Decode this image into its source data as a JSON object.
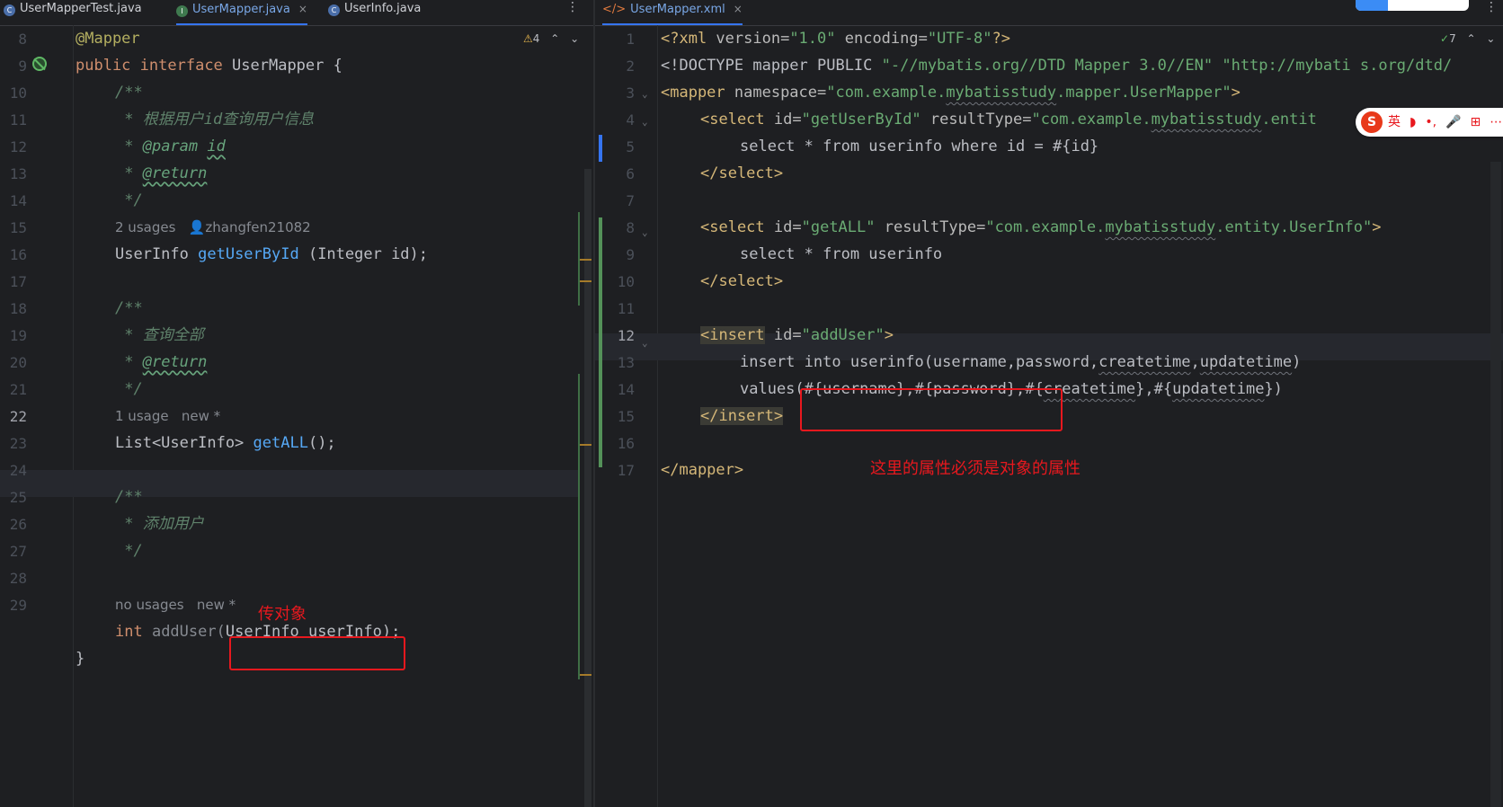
{
  "left_editor": {
    "tabs": [
      {
        "label": "UserMapperTest.java",
        "icon": "class-icon",
        "active": false
      },
      {
        "label": "UserMapper.java",
        "icon": "interface-icon",
        "active": true
      },
      {
        "label": "UserInfo.java",
        "icon": "class-icon",
        "active": false
      }
    ],
    "tab_close": "×",
    "more_menu": "⋮",
    "inspection": {
      "warning_icon": "⚠",
      "count": "4",
      "up": "⌃",
      "down": "⌄"
    },
    "line_numbers": [
      "8",
      "9",
      "10",
      "11",
      "12",
      "13",
      "14",
      "15",
      "16",
      "17",
      "18",
      "19",
      "20",
      "21",
      "22",
      "23",
      "24",
      "25",
      "26",
      "27",
      "28",
      "29"
    ],
    "code": {
      "l8_annotation": "@Mapper",
      "l9_public": "public",
      "l9_interface": "interface",
      "l9_name": " UserMapper {",
      "l10": "/**",
      "l11": " * 根据用户id查询用户信息",
      "l12_star": " * ",
      "l12_tag": "@param",
      "l12_id": "id",
      "l13_star": " * ",
      "l13_tag": "@return",
      "l14": " */",
      "hint1_usages": "2 usages",
      "hint1_author": "zhangfen21082",
      "l15_type": "UserInfo ",
      "l15_fn": "getUserById",
      "l15_rest": " (Integer id);",
      "l17": "/**",
      "l18": " * 查询全部",
      "l19_star": " * ",
      "l19_tag": "@return",
      "l20": " */",
      "hint2_usages": "1 usage",
      "hint2_new": "new *",
      "l21_type": "List<UserInfo> ",
      "l21_fn": "getALL",
      "l21_rest": "();",
      "l23": "/**",
      "l24": " * 添加用户",
      "l25": " */",
      "hint3_usages": "no usages",
      "hint3_new": "new *",
      "l27_int": "int",
      "l27_fn": " addUser(",
      "l27_param": "UserInfo userInfo",
      "l27_rest": ");",
      "l28": "}"
    },
    "annotation_note": "传对象",
    "colors": {
      "annotation_red": "#e8181e",
      "accent_blue": "#3574f0"
    }
  },
  "right_editor": {
    "tab": {
      "label": "UserMapper.xml",
      "icon": "xml-icon",
      "close": "×"
    },
    "more_menu": "⋮",
    "inspection": {
      "check_icon": "✓",
      "count": "7",
      "up": "⌃",
      "down": "⌄"
    },
    "line_numbers": [
      "1",
      "2",
      "3",
      "4",
      "5",
      "6",
      "7",
      "8",
      "9",
      "10",
      "11",
      "12",
      "13",
      "14",
      "15",
      "16",
      "17"
    ],
    "xml": {
      "l1_open": "<?xml ",
      "l1_version_attr": "version=",
      "l1_version_val": "\"1.0\"",
      "l1_enc_attr": " encoding=",
      "l1_enc_val": "\"UTF-8\"",
      "l1_close": "?>",
      "l2_doctype": "<!DOCTYPE mapper PUBLIC ",
      "l2_public": "\"-//mybatis.org//DTD Mapper 3.0//EN\"",
      "l2_system": " \"http://mybati s.org/dtd/",
      "l3_open": "<mapper ",
      "l3_attr": "namespace=",
      "l3_val_a": "\"com.example.",
      "l3_val_b": "mybatisstudy",
      "l3_val_c": ".mapper.UserMapper\"",
      "l3_close": ">",
      "l4_open": "<select ",
      "l4_id_attr": "id=",
      "l4_id_val": "\"getUserById\"",
      "l4_rt_attr": " resultType=",
      "l4_rt_val_a": "\"com.example.",
      "l4_rt_val_b": "mybatisstudy",
      "l4_rt_val_c": ".entit",
      "l5": "select * from userinfo where id = #{id}",
      "l6": "</select>",
      "l8_open": "<select ",
      "l8_id_attr": "id=",
      "l8_id_val": "\"getALL\"",
      "l8_rt_attr": " resultType=",
      "l8_rt_val_a": "\"com.example.",
      "l8_rt_val_b": "mybatisstudy",
      "l8_rt_val_c": ".entity.UserInfo\"",
      "l8_close": ">",
      "l9": "select * from userinfo",
      "l10": "</select>",
      "l12_open": "<insert",
      "l12_attr": " id=",
      "l12_val": "\"addUser\"",
      "l12_close": ">",
      "l13_a": "insert into userinfo(username,password,",
      "l13_b": "createtime",
      "l13_c": ",",
      "l13_d": "updatetime",
      "l13_e": ")",
      "l14_a": "values",
      "l14_b": "(#{username},#{password},#{",
      "l14_c": "createtime",
      "l14_d": "},#{",
      "l14_e": "updatetime",
      "l14_f": "})",
      "l15": "</insert>",
      "l17": "</mapper>"
    },
    "annotation_note": "这里的属性必须是对象的属性"
  },
  "ime_toolbar": {
    "logo": "S",
    "items": [
      "英",
      "◗",
      "•,",
      "🎤",
      "⊞",
      "⋯"
    ]
  }
}
